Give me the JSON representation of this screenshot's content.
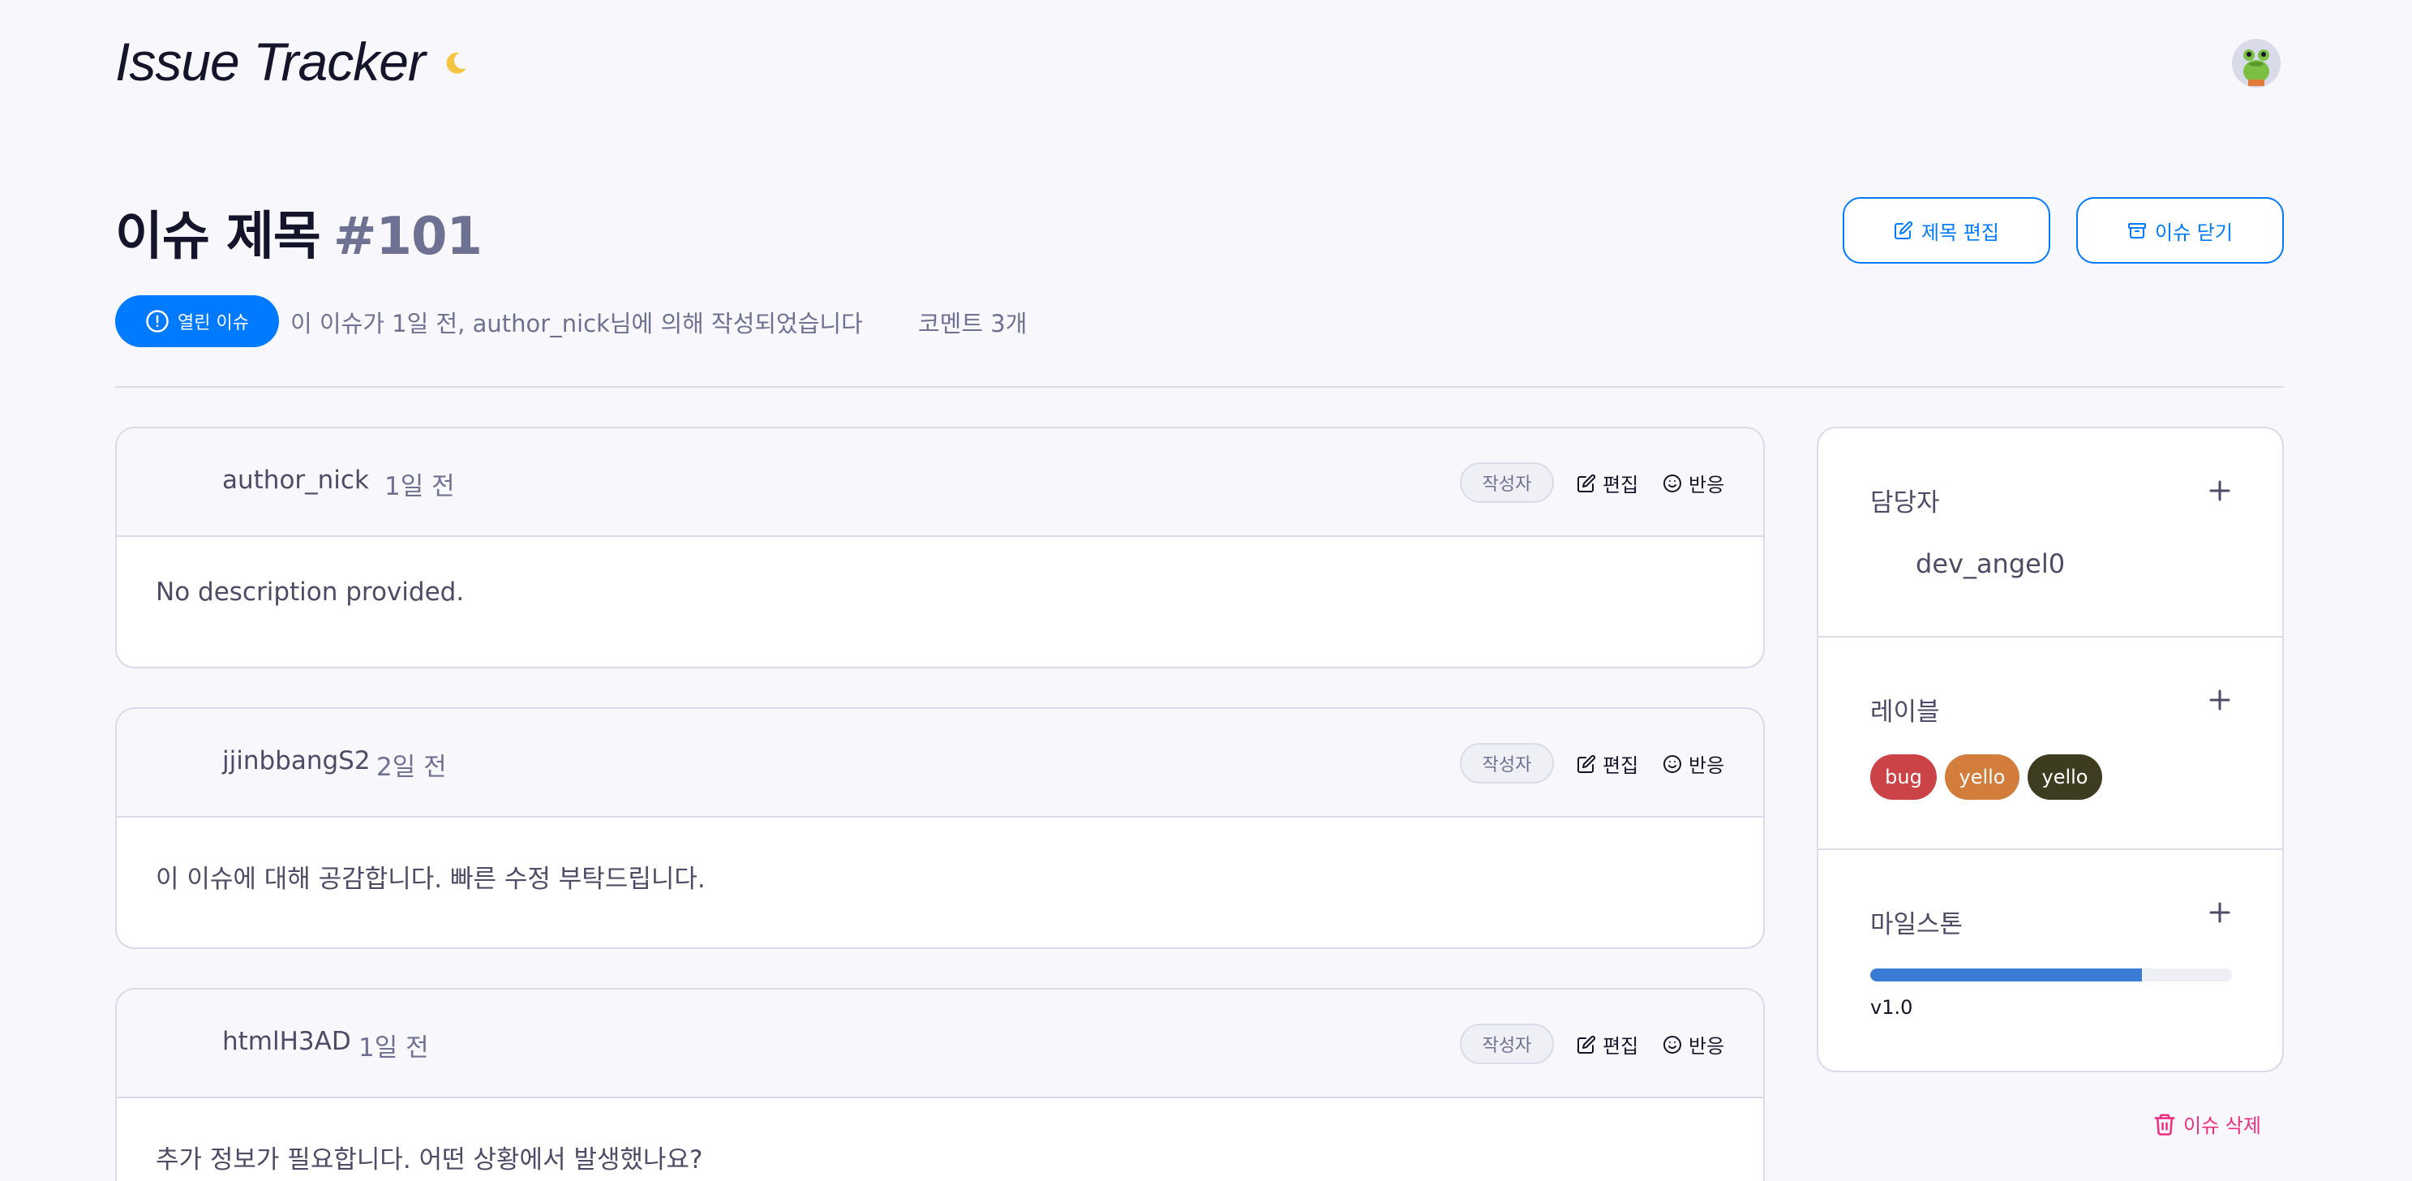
{
  "header": {
    "logo_text": "Issue Tracker",
    "moon_icon": "moon-icon",
    "avatar_icon": "frog-avatar"
  },
  "issue": {
    "title": "이슈 제목",
    "number": "#101",
    "edit_title_label": "제목 편집",
    "close_issue_label": "이슈 닫기",
    "state_label": "열린 이슈",
    "meta_text": "이 이슈가 1일 전, author_nick님에 의해 작성되었습니다",
    "comment_count_text": "코멘트 3개"
  },
  "comments": [
    {
      "author": "author_nick",
      "time": "1일 전",
      "tag": "작성자",
      "edit_label": "편집",
      "react_label": "반응",
      "body": "No description provided."
    },
    {
      "author": "jjinbbangS2",
      "time": "2일 전",
      "tag": "작성자",
      "edit_label": "편집",
      "react_label": "반응",
      "body": "이 이슈에 대해 공감합니다. 빠른 수정 부탁드립니다."
    },
    {
      "author": "htmlH3AD",
      "time": "1일 전",
      "tag": "작성자",
      "edit_label": "편집",
      "react_label": "반응",
      "body": "추가 정보가 필요합니다. 어떤 상황에서 발생했나요?"
    }
  ],
  "sidebar": {
    "assignee_title": "담당자",
    "assignee": "dev_angel0",
    "labels_title": "레이블",
    "labels": [
      {
        "name": "bug",
        "color": "#cc4347"
      },
      {
        "name": "yello",
        "color": "#d27d3b"
      },
      {
        "name": "yello",
        "color": "#3d3c20"
      }
    ],
    "milestone_title": "마일스톤",
    "milestone_progress": 0.75,
    "milestone_name": "v1.0"
  },
  "delete_issue_label": "이슈 삭제",
  "colors": {
    "accent": "#007aff",
    "danger": "#ed2e7e",
    "progress": "#3a7bd5",
    "background": "#f7f7fc"
  }
}
